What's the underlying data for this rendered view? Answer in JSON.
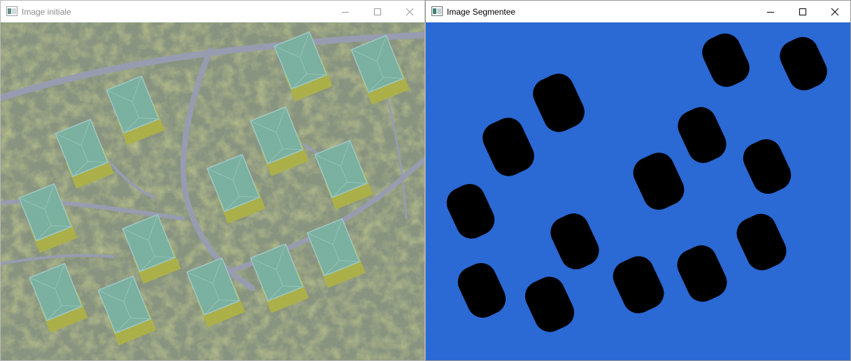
{
  "windows": {
    "left": {
      "title": "Image initiale",
      "active": false,
      "image_icon": "opencv-window-icon",
      "content_image": "aerial-residential-photo",
      "controls": [
        "minimize-icon",
        "maximize-icon",
        "close-icon"
      ]
    },
    "right": {
      "title": "Image Segmentee",
      "active": true,
      "image_icon": "opencv-window-icon",
      "content_image": "segmentation-mask",
      "controls": [
        "minimize-icon",
        "maximize-icon",
        "close-icon"
      ]
    }
  },
  "colors": {
    "segment_background": "#2b69d4",
    "segment_blob": "#000000",
    "aerial_base": "#7e8a78",
    "roof": "#6fae9f",
    "lawn": "#a9ad37",
    "road": "#8f93ad",
    "titlebar_inactive_text": "#8d8d8d",
    "titlebar_active_text": "#000000"
  }
}
